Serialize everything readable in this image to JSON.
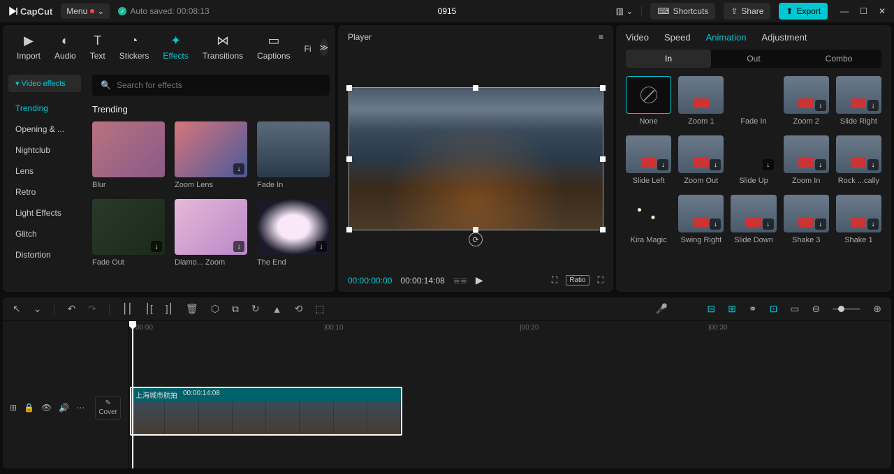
{
  "app": {
    "name": "CapCut"
  },
  "menu": {
    "label": "Menu"
  },
  "autosave": {
    "text": "Auto saved: 00:08:13"
  },
  "projectTitle": "0915",
  "topButtons": {
    "shortcuts": "Shortcuts",
    "share": "Share",
    "export": "Export"
  },
  "mediaTabs": [
    {
      "label": "Import",
      "icon": "▶"
    },
    {
      "label": "Audio",
      "icon": "◐"
    },
    {
      "label": "Text",
      "icon": "T"
    },
    {
      "label": "Stickers",
      "icon": "◔"
    },
    {
      "label": "Effects",
      "icon": "✦",
      "active": true
    },
    {
      "label": "Transitions",
      "icon": "⋈"
    },
    {
      "label": "Captions",
      "icon": "▭"
    },
    {
      "label": "Fi",
      "icon": ""
    }
  ],
  "effectsSidebar": {
    "tag": "Video effects",
    "items": [
      "Trending",
      "Opening & ...",
      "Nightclub",
      "Lens",
      "Retro",
      "Light Effects",
      "Glitch",
      "Distortion"
    ],
    "activeIndex": 0
  },
  "searchPlaceholder": "Search for effects",
  "effectsSection": {
    "title": "Trending",
    "items": [
      {
        "label": "Blur",
        "cls": "thumb-blur",
        "dl": false
      },
      {
        "label": "Zoom Lens",
        "cls": "thumb-zoom",
        "dl": true
      },
      {
        "label": "Fade In",
        "cls": "thumb-fadein",
        "dl": false
      },
      {
        "label": "Fade Out",
        "cls": "thumb-fadeout",
        "dl": true
      },
      {
        "label": "Diamo... Zoom",
        "cls": "thumb-diamond",
        "dl": true
      },
      {
        "label": "The End",
        "cls": "thumb-end",
        "dl": true
      }
    ]
  },
  "player": {
    "title": "Player",
    "currentTime": "00:00:00:00",
    "totalTime": "00:00:14:08",
    "ratio": "Ratio"
  },
  "inspectorTabs": [
    "Video",
    "Speed",
    "Animation",
    "Adjustment"
  ],
  "inspectorActive": 2,
  "animSubtabs": [
    "In",
    "Out",
    "Combo"
  ],
  "animSubActive": 0,
  "animations": [
    {
      "label": "None",
      "type": "none"
    },
    {
      "label": "Zoom 1",
      "type": "cable",
      "dl": false
    },
    {
      "label": "Fade In",
      "type": "dark",
      "dl": false
    },
    {
      "label": "Zoom 2",
      "type": "cable",
      "dl": true
    },
    {
      "label": "Slide Right",
      "type": "cable",
      "dl": true
    },
    {
      "label": "Slide Left",
      "type": "cable",
      "dl": true
    },
    {
      "label": "Zoom Out",
      "type": "cable",
      "dl": true
    },
    {
      "label": "Slide Up",
      "type": "dark",
      "dl": true
    },
    {
      "label": "Zoom In",
      "type": "cable",
      "dl": true
    },
    {
      "label": "Rock ...cally",
      "type": "cable",
      "dl": true
    },
    {
      "label": "Kira Magic",
      "type": "kira",
      "dl": false
    },
    {
      "label": "Swing Right",
      "type": "cable",
      "dl": true
    },
    {
      "label": "Slide Down",
      "type": "cable",
      "dl": true
    },
    {
      "label": "Shake 3",
      "type": "cable",
      "dl": true
    },
    {
      "label": "Shake 1",
      "type": "cable",
      "dl": true
    }
  ],
  "ruler": [
    {
      "label": "00:00",
      "pos": 10
    },
    {
      "label": "|00:10",
      "pos": 280
    },
    {
      "label": "|00:20",
      "pos": 560
    },
    {
      "label": "|00:30",
      "pos": 830
    }
  ],
  "clip": {
    "name": "上海城市航拍",
    "duration": "00:00:14:08"
  },
  "cover": "Cover"
}
